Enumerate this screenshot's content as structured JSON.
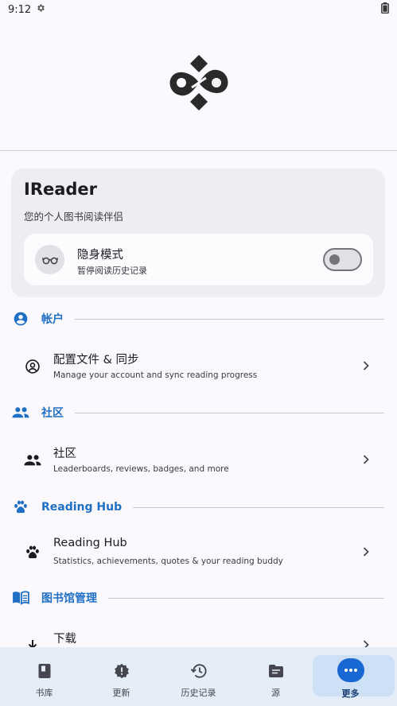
{
  "status_bar": {
    "time": "9:12",
    "settings_icon": "gear-icon",
    "battery_icon": "battery-icon"
  },
  "logo": {
    "icon": "ireader-logo",
    "color": "#2a2a2a"
  },
  "app_card": {
    "name": "IReader",
    "tagline": "您的个人图书阅读伴侣",
    "incognito": {
      "title": "隐身模式",
      "subtitle": "暂停阅读历史记录",
      "icon": "glasses-icon",
      "enabled": false
    }
  },
  "sections": {
    "account": {
      "label": "帐户",
      "icon": "account-circle-icon"
    },
    "community": {
      "label": "社区",
      "icon": "people-icon"
    },
    "reading_hub": {
      "label": "Reading Hub",
      "icon": "paw-icon"
    },
    "library": {
      "label": "图书馆管理",
      "icon": "book-open-icon"
    }
  },
  "rows": {
    "profile_sync": {
      "title": "配置文件 & 同步",
      "subtitle": "Manage your account and sync reading progress",
      "icon": "account-circle-outline-icon"
    },
    "community": {
      "title": "社区",
      "subtitle": "Leaderboards, reviews, badges, and more",
      "icon": "people-icon"
    },
    "reading_hub": {
      "title": "Reading Hub",
      "subtitle": "Statistics, achievements, quotes & your reading buddy",
      "icon": "paw-icon"
    },
    "downloads": {
      "title": "下载",
      "icon": "download-icon"
    }
  },
  "bottom_nav": {
    "items": [
      {
        "label": "书库",
        "icon": "book-icon"
      },
      {
        "label": "更新",
        "icon": "alert-badge-icon"
      },
      {
        "label": "历史记录",
        "icon": "history-icon"
      },
      {
        "label": "源",
        "icon": "folder-icon"
      },
      {
        "label": "更多",
        "icon": "more-horizontal-icon",
        "active": true
      }
    ]
  },
  "colors": {
    "accent": "#1f6fc5",
    "active_pill": "#1967d2",
    "bottom_nav_bg": "#e4edf8",
    "card_bg": "#efedf3"
  }
}
